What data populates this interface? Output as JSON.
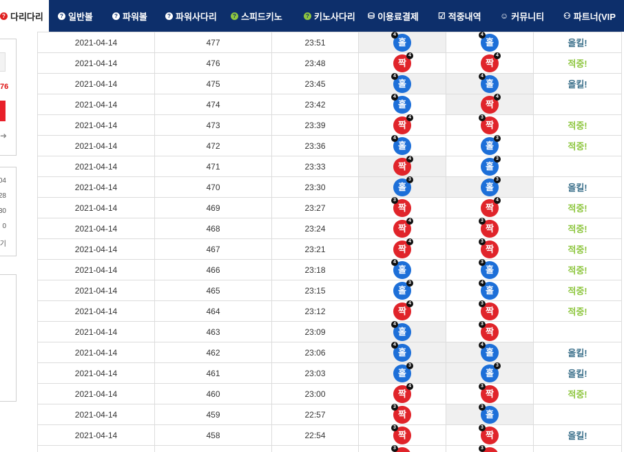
{
  "nav": {
    "items": [
      {
        "label": "다리다리",
        "icon": "question-icon",
        "active": true
      },
      {
        "label": "일반볼",
        "icon": "question-icon",
        "active": false
      },
      {
        "label": "파워볼",
        "icon": "question-icon",
        "active": false
      },
      {
        "label": "파워사다리",
        "icon": "question-icon",
        "active": false
      },
      {
        "label": "스피드키노",
        "icon": "question-icon",
        "active": false
      },
      {
        "label": "키노사다리",
        "icon": "question-icon",
        "active": false
      },
      {
        "label": "이용료결제",
        "icon": "database-icon",
        "active": false
      },
      {
        "label": "적중내역",
        "icon": "checkbox-icon",
        "active": false
      },
      {
        "label": "커뮤니티",
        "icon": "smiley-icon",
        "active": false
      },
      {
        "label": "파트너(VIP",
        "icon": "group-icon",
        "active": false
      }
    ]
  },
  "sidebar": {
    "red_number": "76",
    "stats": [
      "04",
      "28",
      "30",
      "0",
      "기"
    ]
  },
  "colors": {
    "nav_bg": "#0d2f6b",
    "odd_ball": "#1d6fd8",
    "even_ball": "#e0242a",
    "hit_text": "#8ec63f",
    "miss_text": "#3a6f8a"
  },
  "results": {
    "rows": [
      {
        "date": "2021-04-14",
        "round": "477",
        "time": "23:51",
        "result": {
          "label": "홀",
          "color": "blue",
          "badge": "4",
          "pos": "tl"
        },
        "pick": {
          "label": "홀",
          "color": "blue",
          "badge": "4",
          "pos": "tl"
        },
        "hit": "올킬!",
        "hit_type": "bad",
        "grey": "result"
      },
      {
        "date": "2021-04-14",
        "round": "476",
        "time": "23:48",
        "result": {
          "label": "짝",
          "color": "red",
          "badge": "4",
          "pos": "tr"
        },
        "pick": {
          "label": "짝",
          "color": "red",
          "badge": "4",
          "pos": "tr"
        },
        "hit": "적중!",
        "hit_type": "good",
        "grey": ""
      },
      {
        "date": "2021-04-14",
        "round": "475",
        "time": "23:45",
        "result": {
          "label": "홀",
          "color": "blue",
          "badge": "4",
          "pos": "tl"
        },
        "pick": {
          "label": "홀",
          "color": "blue",
          "badge": "4",
          "pos": "tl"
        },
        "hit": "올킬!",
        "hit_type": "bad",
        "grey": "both"
      },
      {
        "date": "2021-04-14",
        "round": "474",
        "time": "23:42",
        "result": {
          "label": "홀",
          "color": "blue",
          "badge": "4",
          "pos": "tl"
        },
        "pick": {
          "label": "짝",
          "color": "red",
          "badge": "4",
          "pos": "tr"
        },
        "hit": "",
        "hit_type": "",
        "grey": "pick"
      },
      {
        "date": "2021-04-14",
        "round": "473",
        "time": "23:39",
        "result": {
          "label": "짝",
          "color": "red",
          "badge": "4",
          "pos": "tr"
        },
        "pick": {
          "label": "짝",
          "color": "red",
          "badge": "3",
          "pos": "tl"
        },
        "hit": "적중!",
        "hit_type": "good",
        "grey": ""
      },
      {
        "date": "2021-04-14",
        "round": "472",
        "time": "23:36",
        "result": {
          "label": "홀",
          "color": "blue",
          "badge": "4",
          "pos": "tl"
        },
        "pick": {
          "label": "홀",
          "color": "blue",
          "badge": "3",
          "pos": "tr"
        },
        "hit": "적중!",
        "hit_type": "good",
        "grey": ""
      },
      {
        "date": "2021-04-14",
        "round": "471",
        "time": "23:33",
        "result": {
          "label": "짝",
          "color": "red",
          "badge": "4",
          "pos": "tr"
        },
        "pick": {
          "label": "홀",
          "color": "blue",
          "badge": "3",
          "pos": "tr"
        },
        "hit": "",
        "hit_type": "",
        "grey": "result"
      },
      {
        "date": "2021-04-14",
        "round": "470",
        "time": "23:30",
        "result": {
          "label": "홀",
          "color": "blue",
          "badge": "3",
          "pos": "tr"
        },
        "pick": {
          "label": "홀",
          "color": "blue",
          "badge": "3",
          "pos": "tr"
        },
        "hit": "올킬!",
        "hit_type": "bad",
        "grey": "both"
      },
      {
        "date": "2021-04-14",
        "round": "469",
        "time": "23:27",
        "result": {
          "label": "짝",
          "color": "red",
          "badge": "3",
          "pos": "tl"
        },
        "pick": {
          "label": "짝",
          "color": "red",
          "badge": "4",
          "pos": "tr"
        },
        "hit": "적중!",
        "hit_type": "good",
        "grey": ""
      },
      {
        "date": "2021-04-14",
        "round": "468",
        "time": "23:24",
        "result": {
          "label": "짝",
          "color": "red",
          "badge": "4",
          "pos": "tr"
        },
        "pick": {
          "label": "짝",
          "color": "red",
          "badge": "3",
          "pos": "tl"
        },
        "hit": "적중!",
        "hit_type": "good",
        "grey": ""
      },
      {
        "date": "2021-04-14",
        "round": "467",
        "time": "23:21",
        "result": {
          "label": "짝",
          "color": "red",
          "badge": "4",
          "pos": "tr"
        },
        "pick": {
          "label": "짝",
          "color": "red",
          "badge": "3",
          "pos": "tl"
        },
        "hit": "적중!",
        "hit_type": "good",
        "grey": ""
      },
      {
        "date": "2021-04-14",
        "round": "466",
        "time": "23:18",
        "result": {
          "label": "홀",
          "color": "blue",
          "badge": "4",
          "pos": "tl"
        },
        "pick": {
          "label": "홀",
          "color": "blue",
          "badge": "3",
          "pos": "tl"
        },
        "hit": "적중!",
        "hit_type": "good",
        "grey": ""
      },
      {
        "date": "2021-04-14",
        "round": "465",
        "time": "23:15",
        "result": {
          "label": "홀",
          "color": "blue",
          "badge": "3",
          "pos": "tr"
        },
        "pick": {
          "label": "홀",
          "color": "blue",
          "badge": "4",
          "pos": "tl"
        },
        "hit": "적중!",
        "hit_type": "good",
        "grey": ""
      },
      {
        "date": "2021-04-14",
        "round": "464",
        "time": "23:12",
        "result": {
          "label": "짝",
          "color": "red",
          "badge": "4",
          "pos": "tr"
        },
        "pick": {
          "label": "짝",
          "color": "red",
          "badge": "3",
          "pos": "tl"
        },
        "hit": "적중!",
        "hit_type": "good",
        "grey": ""
      },
      {
        "date": "2021-04-14",
        "round": "463",
        "time": "23:09",
        "result": {
          "label": "홀",
          "color": "blue",
          "badge": "4",
          "pos": "tl"
        },
        "pick": {
          "label": "짝",
          "color": "red",
          "badge": "3",
          "pos": "tl"
        },
        "hit": "",
        "hit_type": "",
        "grey": "result"
      },
      {
        "date": "2021-04-14",
        "round": "462",
        "time": "23:06",
        "result": {
          "label": "홀",
          "color": "blue",
          "badge": "4",
          "pos": "tl"
        },
        "pick": {
          "label": "홀",
          "color": "blue",
          "badge": "4",
          "pos": "tl"
        },
        "hit": "올킬!",
        "hit_type": "bad",
        "grey": "both"
      },
      {
        "date": "2021-04-14",
        "round": "461",
        "time": "23:03",
        "result": {
          "label": "홀",
          "color": "blue",
          "badge": "3",
          "pos": "tr"
        },
        "pick": {
          "label": "홀",
          "color": "blue",
          "badge": "3",
          "pos": "tr"
        },
        "hit": "올킬!",
        "hit_type": "bad",
        "grey": "both"
      },
      {
        "date": "2021-04-14",
        "round": "460",
        "time": "23:00",
        "result": {
          "label": "짝",
          "color": "red",
          "badge": "4",
          "pos": "tr"
        },
        "pick": {
          "label": "짝",
          "color": "red",
          "badge": "3",
          "pos": "tl"
        },
        "hit": "적중!",
        "hit_type": "good",
        "grey": ""
      },
      {
        "date": "2021-04-14",
        "round": "459",
        "time": "22:57",
        "result": {
          "label": "짝",
          "color": "red",
          "badge": "3",
          "pos": "tl"
        },
        "pick": {
          "label": "홀",
          "color": "blue",
          "badge": "3",
          "pos": "tl"
        },
        "hit": "",
        "hit_type": "",
        "grey": "pick"
      },
      {
        "date": "2021-04-14",
        "round": "458",
        "time": "22:54",
        "result": {
          "label": "짝",
          "color": "red",
          "badge": "3",
          "pos": "tl"
        },
        "pick": {
          "label": "짝",
          "color": "red",
          "badge": "3",
          "pos": "tl"
        },
        "hit": "올킬!",
        "hit_type": "bad",
        "grey": ""
      },
      {
        "date": "",
        "round": "",
        "time": "",
        "result": {
          "label": "",
          "color": "red",
          "badge": "3",
          "pos": "tl"
        },
        "pick": {
          "label": "",
          "color": "red",
          "badge": "3",
          "pos": "tl"
        },
        "hit": "",
        "hit_type": "bad",
        "grey": ""
      }
    ]
  }
}
